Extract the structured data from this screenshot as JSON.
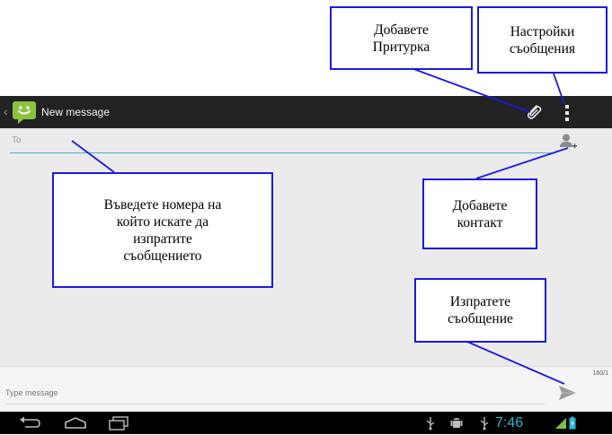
{
  "action_bar": {
    "title": "New message",
    "app_icon": "messaging-smiley-icon",
    "actions": [
      "paperclip-icon",
      "overflow-menu-icon"
    ]
  },
  "recipient": {
    "placeholder": "To",
    "add_contact_icon": "add-contact-icon"
  },
  "composer": {
    "char_counter": "160/1",
    "placeholder": "Type message",
    "send_icon": "send-icon"
  },
  "system_bar": {
    "nav_icons": [
      "back-icon",
      "home-icon",
      "recent-apps-icon"
    ],
    "status_icons": [
      "usb-icon",
      "android-debug-icon",
      "usb-icon",
      "signal-icon",
      "battery-icon"
    ],
    "clock": "7:46"
  },
  "callouts": {
    "attachment": [
      "Добавете",
      "Притурка"
    ],
    "settings": [
      "Настройки",
      "съобщения"
    ],
    "recipient": [
      "Въведете номера на",
      "който искате да",
      "изпратите",
      "съобщението"
    ],
    "contact": [
      "Добавете",
      "контакт"
    ],
    "send": [
      "Изпратете",
      "съобщение"
    ]
  },
  "colors": {
    "action_bar": "#222222",
    "content_bg": "#ebebeb",
    "accent_line": "#4ea8c8",
    "clock": "#2bb6d6",
    "callout_border": "#1a1ae0",
    "app_icon_green": "#8ac43f"
  }
}
